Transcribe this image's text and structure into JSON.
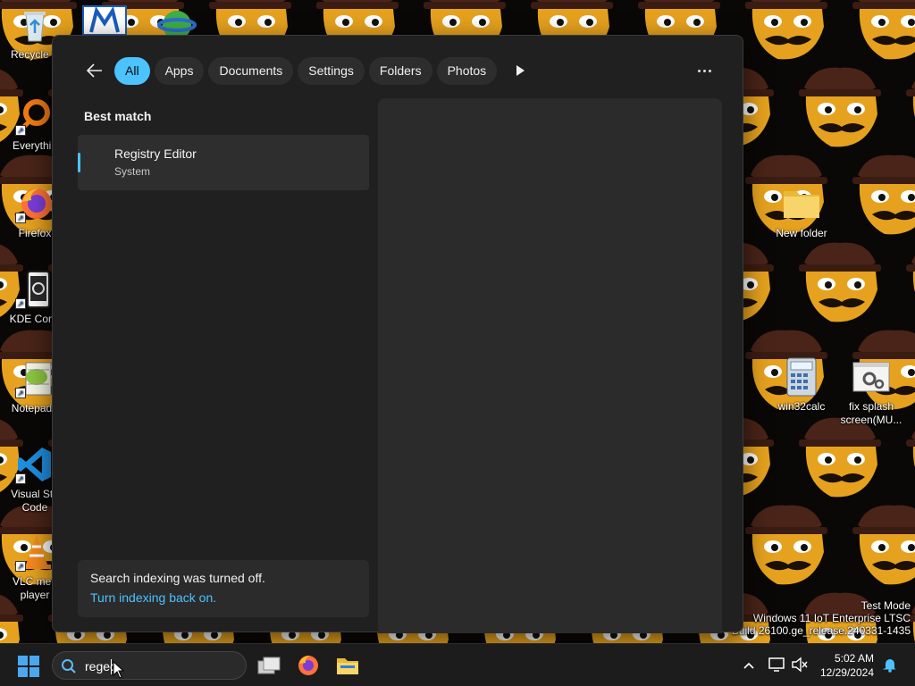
{
  "desktop": {
    "icons": [
      {
        "label": "Recycle B"
      },
      {
        "label": "Everythin"
      },
      {
        "label": "Firefox"
      },
      {
        "label": "KDE Conn"
      },
      {
        "label": "Notepad+"
      },
      {
        "label": "Visual Stu\nCode"
      },
      {
        "label": "VLC med\nplayer"
      },
      {
        "label": "New folder"
      },
      {
        "label": "win32calc"
      },
      {
        "label": "fix splash\nscreen(MU..."
      }
    ],
    "watermark": [
      "Test Mode",
      "Windows 11 IoT Enterprise LTSC",
      "Build 26100.ge_release.240331-1435"
    ]
  },
  "search_flyout": {
    "filters": [
      {
        "label": "All",
        "active": true
      },
      {
        "label": "Apps"
      },
      {
        "label": "Documents"
      },
      {
        "label": "Settings"
      },
      {
        "label": "Folders"
      },
      {
        "label": "Photos"
      }
    ],
    "best_match_title": "Best match",
    "best_match": {
      "title": "Registry Editor",
      "subtitle": "System"
    },
    "notice": {
      "text": "Search indexing was turned off.",
      "link": "Turn indexing back on."
    }
  },
  "taskbar": {
    "search_query": "regec",
    "clock": {
      "time": "5:02 AM",
      "date": "12/29/2024"
    }
  },
  "colors": {
    "accent": "#4cc2ff",
    "flyout_bg": "#202020",
    "wallpaper_orange": "#e6a21e"
  }
}
